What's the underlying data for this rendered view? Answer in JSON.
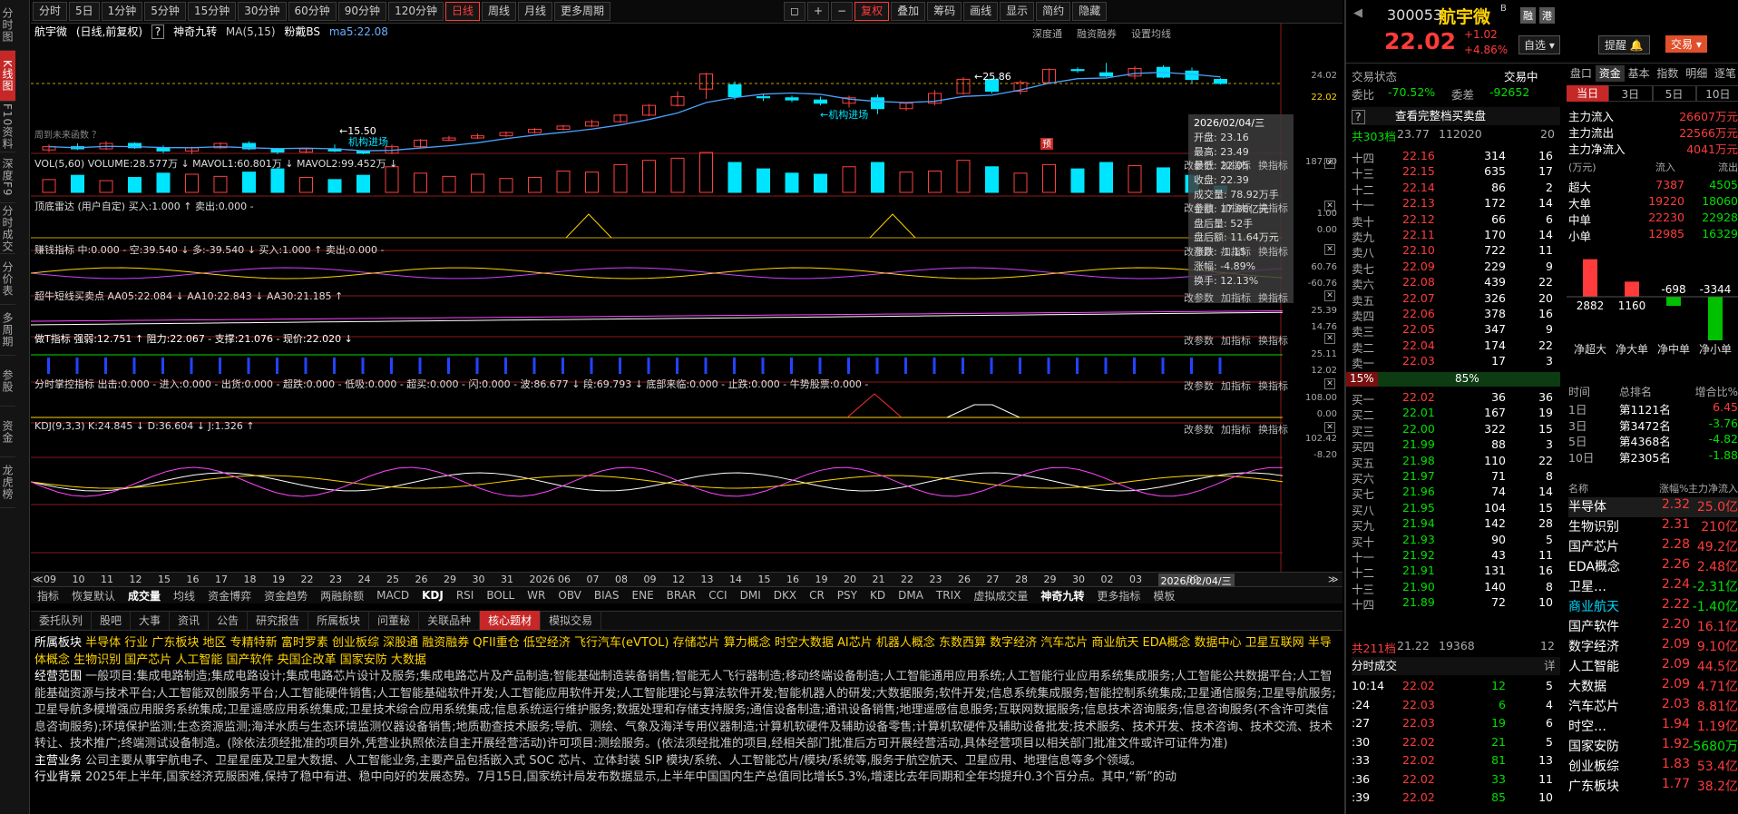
{
  "left_tabs": [
    "分时图",
    "K线图",
    "F10资料",
    "深度F9",
    "分时成交",
    "分价表",
    "多周期",
    "参股",
    "资金",
    "龙虎榜"
  ],
  "toolbar": {
    "periods": [
      "分时",
      "5日",
      "1分钟",
      "5分钟",
      "15分钟",
      "30分钟",
      "60分钟",
      "90分钟",
      "120分钟",
      "日线",
      "周线",
      "月线",
      "更多周期"
    ],
    "active": "日线",
    "right": [
      "复权",
      "叠加",
      "筹码",
      "画线",
      "显示",
      "简约",
      "隐藏"
    ]
  },
  "main_title": {
    "name": "航宇微",
    "mode": "(日线,前复权)",
    "indicator": "神奇九转",
    "ma": "MA(5,15)",
    "bs": "粉戴BS",
    "ma5": "ma5:22.08",
    "right": [
      "深度通",
      "融资融券",
      "设置均线"
    ]
  },
  "yaxis": {
    "price_top": "24.02",
    "price_cur": "22.02",
    "vol_top": "187.00",
    "radar": [
      "1.00",
      "0.00"
    ],
    "earn": [
      "60.76",
      "-60.76"
    ],
    "super": [
      "25.39",
      "14.76"
    ],
    "t_ind": [
      "25.11",
      "12.02"
    ],
    "fenshi": [
      "108.00",
      "0.00"
    ],
    "kdj": [
      "102.42",
      "-8.20"
    ]
  },
  "annotations": {
    "hi": "←25.86",
    "lo": "←15.50",
    "jg1": "机构进场",
    "jg2": "←机构进场",
    "future": "周到未来函数 ？",
    "pred": "预"
  },
  "tooltip": {
    "date": "2026/02/04/三",
    "rows": [
      "开盘: 23.16",
      "最高: 23.49",
      "最低: 22.05",
      "收盘: 22.39",
      "成交量: 78.92万手",
      "金额: 17.86亿元",
      "盘后量: 52手",
      "盘后额: 11.64万元",
      "涨跌: -1.15",
      "涨幅: -4.89%",
      "换手: 12.13%"
    ]
  },
  "panels": {
    "vol": "VOL(5,60)  VOLUME:28.577万 ↓ MAVOL1:60.801万 ↓ MAVOL2:99.452万 ↓",
    "radar": "顶底雷达 (用户自定)  买入:1.000 ↑ 卖出:0.000 -",
    "earn": "赚钱指标  中:0.000 - 空:39.540 ↓ 多:-39.540 ↓ 买入:1.000 ↑ 卖出:0.000 -",
    "super": "超牛短线买卖点  AA05:22.084 ↓ AA10:22.843 ↓ AA30:21.185 ↑",
    "t": "做T指标  强弱:12.751 ↑ 阻力:22.067 - 支撑:21.076 - 现价:22.020 ↓",
    "fs": "分时掌控指标  出击:0.000 - 进入:0.000 - 出货:0.000 - 超跌:0.000 - 低吸:0.000 - 超买:0.000 - 闪:0.000 - 波:86.677 ↓ 段:69.793 ↓ 底部来临:0.000 - 止跌:0.000 - 牛势股票:0.000 -",
    "kdj": "KDJ(9,3,3)  K:24.845 ↓ D:36.604 ↓ J:1.326 ↑",
    "right": [
      "改参数",
      "加指标",
      "换指标"
    ]
  },
  "dates": [
    "09",
    "10",
    "11",
    "12",
    "15",
    "16",
    "17",
    "18",
    "19",
    "22",
    "23",
    "24",
    "25",
    "26",
    "29",
    "30",
    "31",
    "2026",
    "06",
    "07",
    "08",
    "09",
    "12",
    "13",
    "14",
    "15",
    "16",
    "19",
    "20",
    "21",
    "22",
    "23",
    "26",
    "27",
    "28",
    "29",
    "30",
    "02",
    "03",
    "2026/02/04/三",
    "09"
  ],
  "ind_tabs": [
    "指标",
    "恢复默认",
    "成交量",
    "均线",
    "资金博弈",
    "资金趋势",
    "两融餘额",
    "MACD",
    "KDJ",
    "RSI",
    "BOLL",
    "WR",
    "OBV",
    "BIAS",
    "ENE",
    "BRAR",
    "CCI",
    "DMI",
    "DKX",
    "CR",
    "PSY",
    "KD",
    "DMA",
    "TRIX",
    "虚拟成交量",
    "神奇九转",
    "更多指标",
    "模板"
  ],
  "info_tabs": [
    "委托队列",
    "股吧",
    "大事",
    "资讯",
    "公告",
    "研究报告",
    "所属板块",
    "问董秘",
    "关联品种",
    "核心题材",
    "模拟交易"
  ],
  "info_active": "核心题材",
  "info": {
    "sector_label": "所属板块",
    "sectors": "半导体 行业  广东板块 地区  专精特新  富时罗素  创业板综  深股通  融资融券  QFII重仓  低空经济  飞行汽车(eVTOL)  存储芯片  算力概念  时空大数据  AI芯片  机器人概念  东数西算  数字经济  汽车芯片  商业航天  EDA概念  数据中心  卫星互联网  半导体概念  生物识别  国产芯片  人工智能  国产软件  央国企改革  国家安防  大数据",
    "scope_label": "经营范围",
    "scope": "一般项目:集成电路制造;集成电路设计;集成电路芯片设计及服务;集成电路芯片及产品制造;智能基础制造装备销售;智能无人飞行器制造;移动终端设备制造;人工智能通用应用系统;人工智能行业应用系统集成服务;人工智能公共数据平台;人工智能基础资源与技术平台;人工智能双创服务平台;人工智能硬件销售;人工智能基础软件开发;人工智能应用软件开发;人工智能理论与算法软件开发;智能机器人的研发;大数据服务;软件开发;信息系统集成服务;智能控制系统集成;卫星通信服务;卫星导航服务;卫星导航多模增强应用服务系统集成;卫星遥感应用系统集成;卫星技术综合应用系统集成;信息系统运行维护服务;数据处理和存储支持服务;通信设备制造;通讯设备销售;地理遥感信息服务;互联网数据服务;信息技术咨询服务;信息咨询服务(不含许可类信息咨询服务);环境保护监测;生态资源监测;海洋水质与生态环境监测仪器设备销售;地质勘查技术服务;导航、测绘、气象及海洋专用仪器制造;计算机软硬件及辅助设备零售;计算机软硬件及辅助设备批发;技术服务、技术开发、技术咨询、技术交流、技术转让、技术推广;终端测试设备制造。(除依法须经批准的项目外,凭营业执照依法自主开展经营活动)许可项目:测绘服务。(依法须经批准的项目,经相关部门批准后方可开展经营活动,具体经营项目以相关部门批准文件或许可证件为准)",
    "main_label": "主营业务",
    "main": "公司主要从事宇航电子、卫星星座及卫星大数据、人工智能业务,主要产品包括嵌入式 SOC 芯片、立体封装 SIP 模块/系统、人工智能芯片/模块/系统等,服务于航空航天、卫星应用、地理信息等多个领域。",
    "bg_label": "行业背景",
    "bg": "2025年上半年,国家经济克服困难,保持了稳中有进、稳中向好的发展态势。7月15日,国家统计局发布数据显示,上半年中国国内生产总值同比增长5.3%,增速比去年同期和全年均提升0.3个百分点。其中,“新”的动"
  },
  "quote": {
    "code": "300053",
    "name": "航宇微",
    "price": "22.02",
    "chg": "+1.02",
    "pct": "+4.86%",
    "btns": [
      "融",
      "港",
      "自选",
      "提醒",
      "交易"
    ]
  },
  "ob": {
    "status_label": "交易状态",
    "status": "交易中",
    "wb_label": "委比",
    "wb": "-70.52%",
    "wc_label": "委差",
    "wc": "-92652",
    "header": "查看完整档买卖盘",
    "total_label": "共303档",
    "total_price": "23.77",
    "total_vol": "112020",
    "total_n": "20",
    "sells": [
      [
        "十四",
        "22.16",
        "314",
        "16"
      ],
      [
        "十三",
        "22.15",
        "635",
        "17"
      ],
      [
        "十二",
        "22.14",
        "86",
        "2"
      ],
      [
        "十一",
        "22.13",
        "172",
        "14"
      ],
      [
        "卖十",
        "22.12",
        "66",
        "6"
      ],
      [
        "卖九",
        "22.11",
        "170",
        "14"
      ],
      [
        "卖八",
        "22.10",
        "722",
        "11"
      ],
      [
        "卖七",
        "22.09",
        "229",
        "9"
      ],
      [
        "卖六",
        "22.08",
        "439",
        "22"
      ],
      [
        "卖五",
        "22.07",
        "326",
        "20"
      ],
      [
        "卖四",
        "22.06",
        "378",
        "16"
      ],
      [
        "卖三",
        "22.05",
        "347",
        "9"
      ],
      [
        "卖二",
        "22.04",
        "174",
        "22"
      ],
      [
        "卖一",
        "22.03",
        "17",
        "3"
      ]
    ],
    "ratio_l": "15%",
    "ratio_r": "85%",
    "buys": [
      [
        "买一",
        "22.02",
        "36",
        "36"
      ],
      [
        "买二",
        "22.01",
        "167",
        "19"
      ],
      [
        "买三",
        "22.00",
        "322",
        "15"
      ],
      [
        "买四",
        "21.99",
        "88",
        "3"
      ],
      [
        "买五",
        "21.98",
        "110",
        "22"
      ],
      [
        "买六",
        "21.97",
        "71",
        "8"
      ],
      [
        "买七",
        "21.96",
        "74",
        "14"
      ],
      [
        "买八",
        "21.95",
        "104",
        "15"
      ],
      [
        "买九",
        "21.94",
        "142",
        "28"
      ],
      [
        "买十",
        "21.93",
        "90",
        "5"
      ],
      [
        "十一",
        "21.92",
        "43",
        "11"
      ],
      [
        "十二",
        "21.91",
        "131",
        "16"
      ],
      [
        "十三",
        "21.90",
        "140",
        "8"
      ],
      [
        "十四",
        "21.89",
        "72",
        "10"
      ]
    ],
    "btotal_label": "共211档",
    "btotal_price": "21.22",
    "btotal_vol": "19368",
    "btotal_n": "12",
    "trades_title": "分时成交",
    "trades_more": "详",
    "trades": [
      [
        "10:14",
        "22.02",
        "12",
        "5"
      ],
      [
        ":24",
        "22.03",
        "6",
        "4"
      ],
      [
        ":27",
        "22.03",
        "19",
        "6"
      ],
      [
        ":30",
        "22.02",
        "21",
        "5"
      ],
      [
        ":33",
        "22.02",
        "81",
        "13"
      ],
      [
        ":36",
        "22.02",
        "33",
        "11"
      ],
      [
        ":39",
        "22.02",
        "85",
        "10"
      ]
    ]
  },
  "cf": {
    "tabs": [
      "盘口",
      "资金",
      "基本",
      "指数",
      "明细",
      "逐笔"
    ],
    "sub": [
      "当日",
      "3日",
      "5日",
      "10日"
    ],
    "main": [
      [
        "主力流入",
        "26607万元"
      ],
      [
        "主力流出",
        "22566万元"
      ],
      [
        "主力净流入",
        "4041万元"
      ]
    ],
    "unit": "(万元)",
    "in": "流入",
    "out": "流出",
    "rows": [
      [
        "超大",
        "7387",
        "4505"
      ],
      [
        "大单",
        "19220",
        "18060"
      ],
      [
        "中单",
        "22230",
        "22928"
      ],
      [
        "小单",
        "12985",
        "16329"
      ]
    ],
    "bars": [
      {
        "v": 2882
      },
      {
        "v": 1160
      },
      {
        "v": -698
      },
      {
        "v": -3344
      }
    ],
    "barlbl": [
      "净超大",
      "净大单",
      "净中单",
      "净小单"
    ],
    "rank_head": [
      "时间",
      "总排名",
      "增合比%"
    ],
    "ranks": [
      [
        "1日",
        "第1121名",
        "6.45"
      ],
      [
        "3日",
        "第3472名",
        "-3.76"
      ],
      [
        "5日",
        "第4368名",
        "-4.82"
      ],
      [
        "10日",
        "第2305名",
        "-1.88"
      ]
    ],
    "sec_head": [
      "名称",
      "涨幅%",
      "主力净流入"
    ],
    "sectors": [
      [
        "半导体",
        "2.32",
        "25.0亿"
      ],
      [
        "生物识别",
        "2.31",
        "210亿"
      ],
      [
        "国产芯片",
        "2.28",
        "49.2亿"
      ],
      [
        "EDA概念",
        "2.26",
        "2.48亿"
      ],
      [
        "卫星…",
        "2.24",
        "-2.31亿"
      ],
      [
        "商业航天",
        "2.22",
        "-1.40亿"
      ],
      [
        "国产软件",
        "2.20",
        "16.1亿"
      ],
      [
        "数字经济",
        "2.09",
        "9.10亿"
      ],
      [
        "人工智能",
        "2.09",
        "44.5亿"
      ],
      [
        "大数据",
        "2.09",
        "4.71亿"
      ],
      [
        "汽车芯片",
        "2.03",
        "8.81亿"
      ],
      [
        "时空…",
        "1.94",
        "1.19亿"
      ],
      [
        "国家安防",
        "1.92",
        "-5680万"
      ],
      [
        "创业板综",
        "1.83",
        "53.4亿"
      ],
      [
        "广东板块",
        "1.77",
        "38.2亿"
      ]
    ]
  },
  "chart_data": {
    "type": "candlestick",
    "ohlc": [
      [
        15.9,
        16.4,
        15.7,
        16.2
      ],
      [
        16.2,
        16.5,
        15.9,
        16.0
      ],
      [
        16.0,
        16.7,
        15.9,
        16.5
      ],
      [
        16.5,
        16.6,
        16.0,
        16.1
      ],
      [
        16.1,
        16.3,
        15.6,
        15.8
      ],
      [
        15.8,
        16.2,
        15.5,
        16.1
      ],
      [
        16.1,
        16.6,
        16.0,
        16.5
      ],
      [
        16.5,
        16.7,
        15.9,
        16.0
      ],
      [
        16.0,
        16.1,
        15.5,
        15.7
      ],
      [
        15.7,
        16.1,
        15.6,
        16.0
      ],
      [
        16.0,
        16.4,
        15.7,
        15.8
      ],
      [
        15.8,
        15.9,
        15.5,
        15.6
      ],
      [
        15.6,
        16.4,
        15.5,
        16.2
      ],
      [
        16.2,
        16.9,
        16.1,
        16.8
      ],
      [
        16.8,
        17.2,
        16.7,
        17.0
      ],
      [
        17.0,
        17.4,
        16.9,
        17.2
      ],
      [
        17.2,
        17.6,
        17.1,
        17.5
      ],
      [
        17.5,
        17.9,
        17.4,
        17.8
      ],
      [
        17.8,
        18.2,
        17.7,
        18.1
      ],
      [
        18.1,
        18.7,
        18.0,
        18.5
      ],
      [
        18.5,
        19.2,
        18.4,
        19.1
      ],
      [
        19.1,
        20.1,
        19.0,
        20.0
      ],
      [
        20.0,
        21.3,
        19.9,
        20.8
      ],
      [
        21.5,
        23.0,
        20.6,
        22.9
      ],
      [
        21.9,
        22.2,
        20.5,
        20.8
      ],
      [
        20.8,
        21.1,
        20.4,
        20.7
      ],
      [
        20.7,
        20.9,
        20.3,
        20.5
      ],
      [
        20.5,
        20.8,
        20.0,
        20.2
      ],
      [
        20.2,
        20.9,
        19.8,
        20.7
      ],
      [
        20.7,
        21.0,
        19.2,
        19.7
      ],
      [
        19.7,
        20.3,
        19.5,
        20.2
      ],
      [
        20.2,
        21.4,
        20.0,
        21.1
      ],
      [
        21.1,
        22.6,
        21.0,
        22.4
      ],
      [
        22.4,
        22.5,
        21.1,
        21.3
      ],
      [
        21.3,
        22.3,
        21.0,
        22.1
      ],
      [
        22.1,
        23.4,
        22.0,
        23.3
      ],
      [
        23.3,
        23.5,
        23.0,
        23.2
      ],
      [
        23.0,
        23.9,
        22.6,
        22.7
      ],
      [
        22.7,
        23.6,
        22.4,
        23.4
      ],
      [
        23.5,
        23.7,
        22.5,
        22.6
      ],
      [
        23.16,
        23.49,
        22.05,
        22.39
      ],
      [
        22.39,
        22.5,
        21.9,
        22.02
      ]
    ],
    "vol_range": [
      0,
      187
    ]
  }
}
